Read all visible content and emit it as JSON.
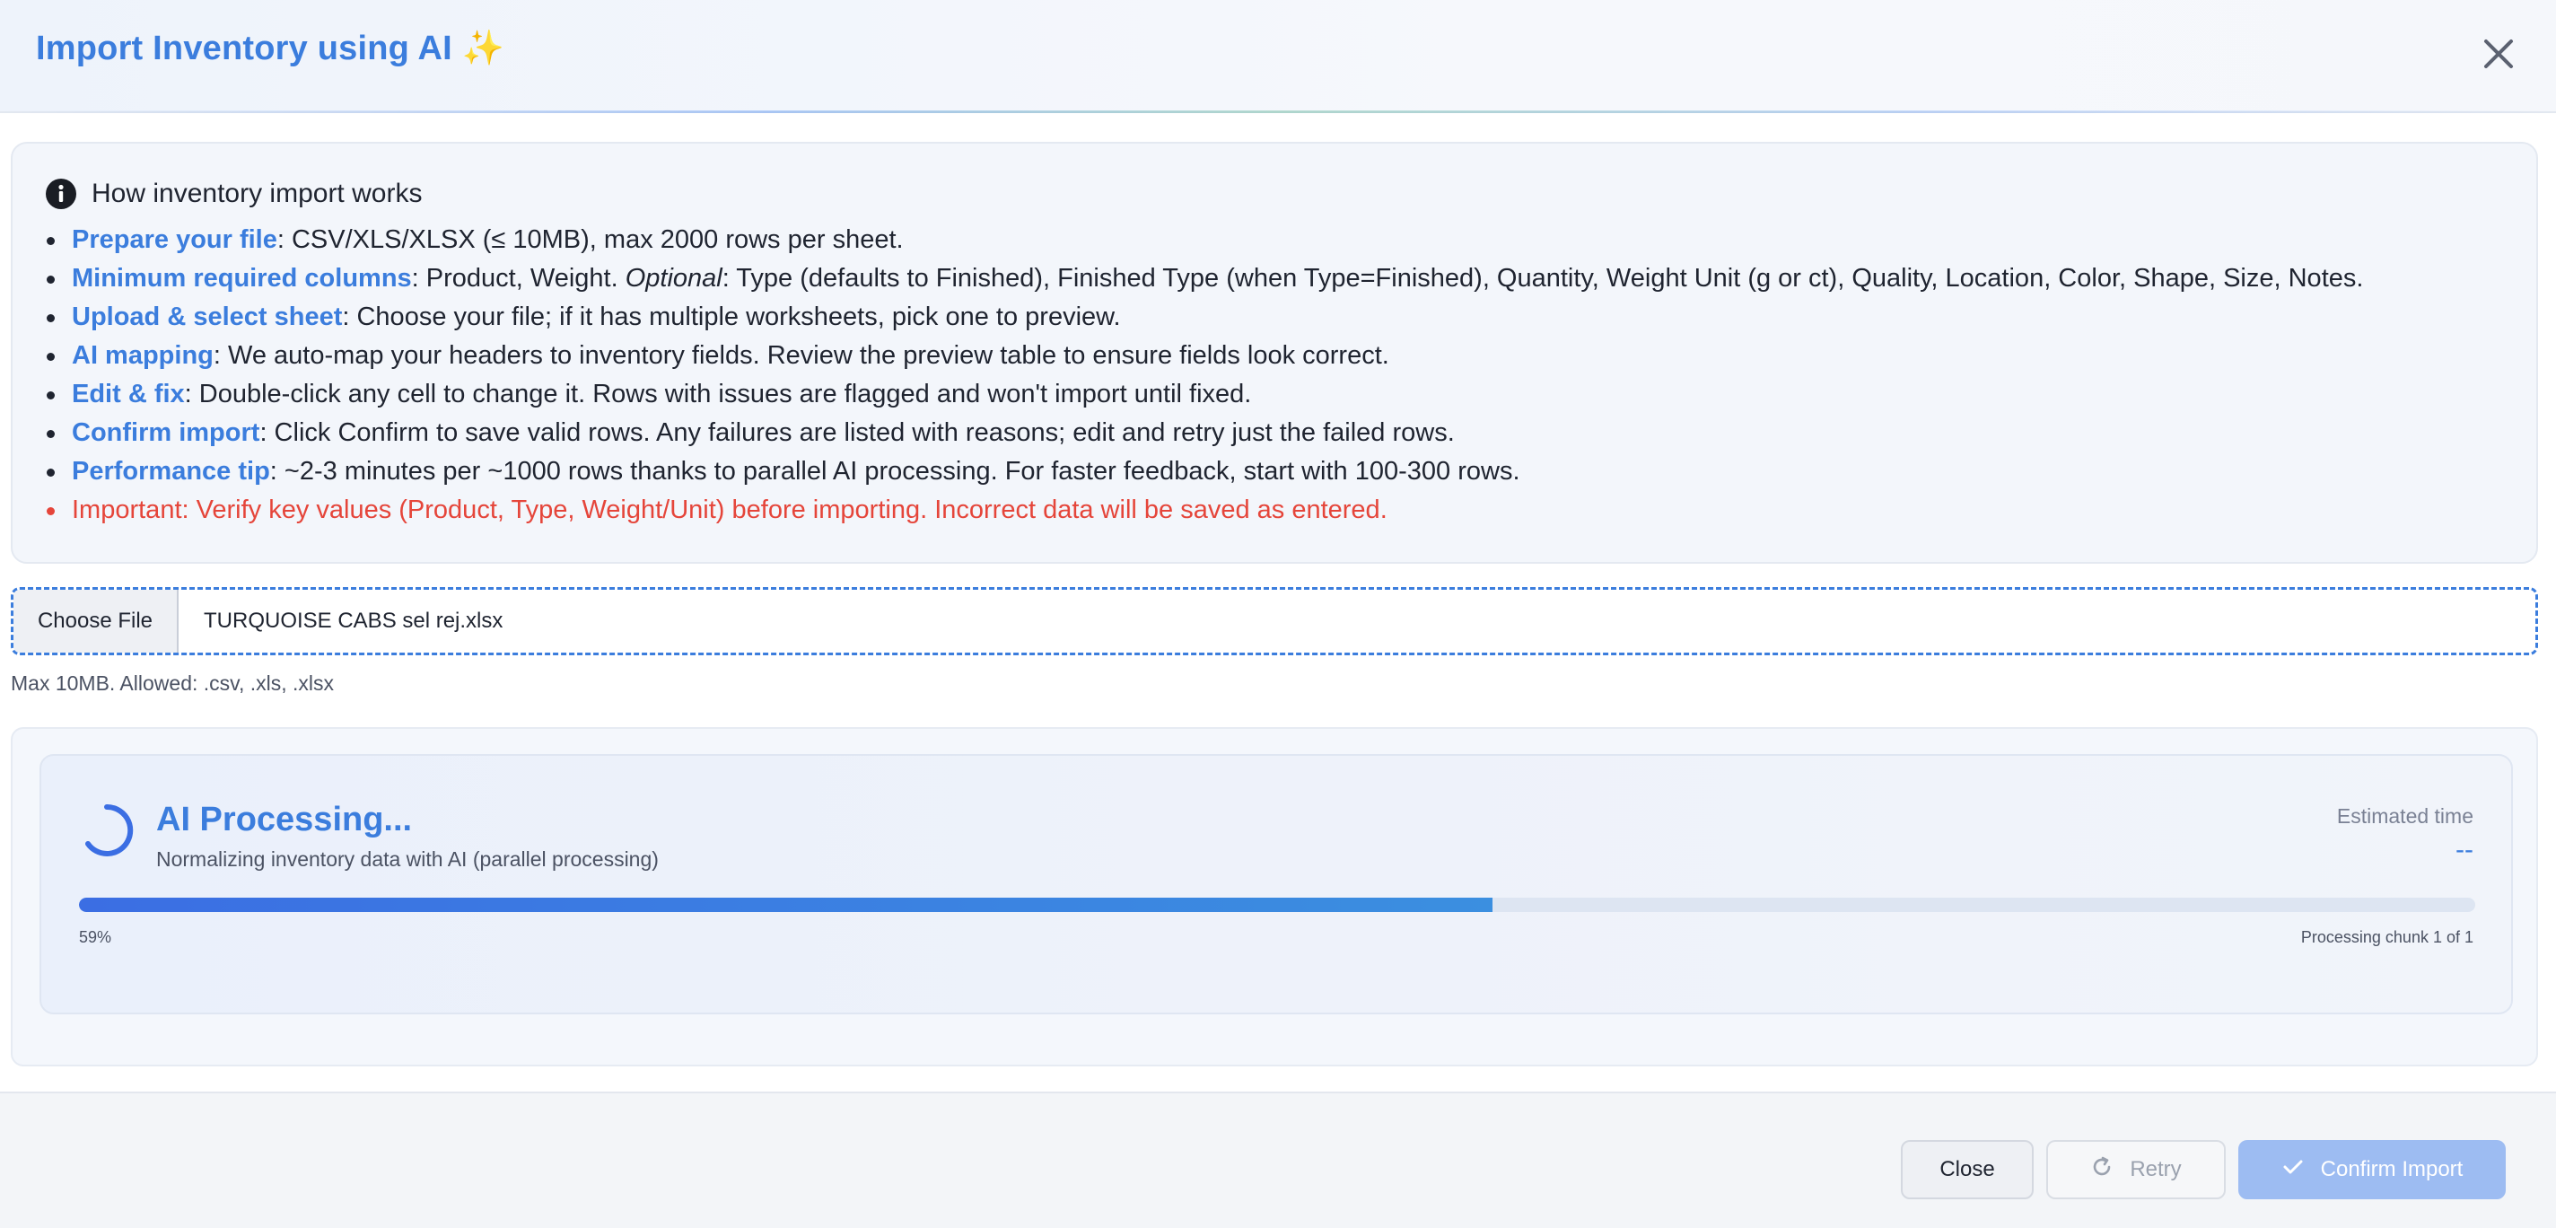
{
  "header": {
    "title": "Import Inventory using AI ✨"
  },
  "info": {
    "heading": "How inventory import works",
    "items": [
      {
        "label": "Prepare your file",
        "text": ": CSV/XLS/XLSX (≤ 10MB), max 2000 rows per sheet."
      },
      {
        "label": "Minimum required columns",
        "text_a": ": Product, Weight. ",
        "optional": "Optional",
        "text_b": ": Type (defaults to Finished), Finished Type (when Type=Finished), Quantity, Weight Unit (g or ct), Quality, Location, Color, Shape, Size, Notes."
      },
      {
        "label": "Upload & select sheet",
        "text": ": Choose your file; if it has multiple worksheets, pick one to preview."
      },
      {
        "label": "AI mapping",
        "text": ": We auto-map your headers to inventory fields. Review the preview table to ensure fields look correct."
      },
      {
        "label": "Edit & fix",
        "text": ": Double-click any cell to change it. Rows with issues are flagged and won't import until fixed."
      },
      {
        "label": "Confirm import",
        "text": ": Click Confirm to save valid rows. Any failures are listed with reasons; edit and retry just the failed rows."
      },
      {
        "label": "Performance tip",
        "text": ": ~2-3 minutes per ~1000 rows thanks to parallel AI processing. For faster feedback, start with 100-300 rows."
      }
    ],
    "warning": "Important: Verify key values (Product, Type, Weight/Unit) before importing. Incorrect data will be saved as entered."
  },
  "file": {
    "choose_label": "Choose File",
    "file_name": "TURQUOISE CABS sel rej.xlsx",
    "hint": "Max 10MB. Allowed: .csv, .xls, .xlsx"
  },
  "processing": {
    "title": "AI Processing...",
    "subtitle": "Normalizing inventory data with AI (parallel processing)",
    "estimate_label": "Estimated time",
    "estimate_value": "--",
    "progress": 59,
    "progress_label": "59%",
    "chunk_label": "Processing chunk 1 of 1"
  },
  "footer": {
    "close_label": "Close",
    "retry_label": "Retry",
    "confirm_label": "Confirm Import"
  },
  "colors": {
    "accent": "#3b7ddd",
    "warning": "#e5453a",
    "confirm_disabled": "#9dbcf2"
  },
  "icons": {
    "close": "close-icon",
    "info": "info-icon",
    "spinner": "spinner-icon",
    "retry": "refresh-icon",
    "confirm": "check-icon"
  }
}
